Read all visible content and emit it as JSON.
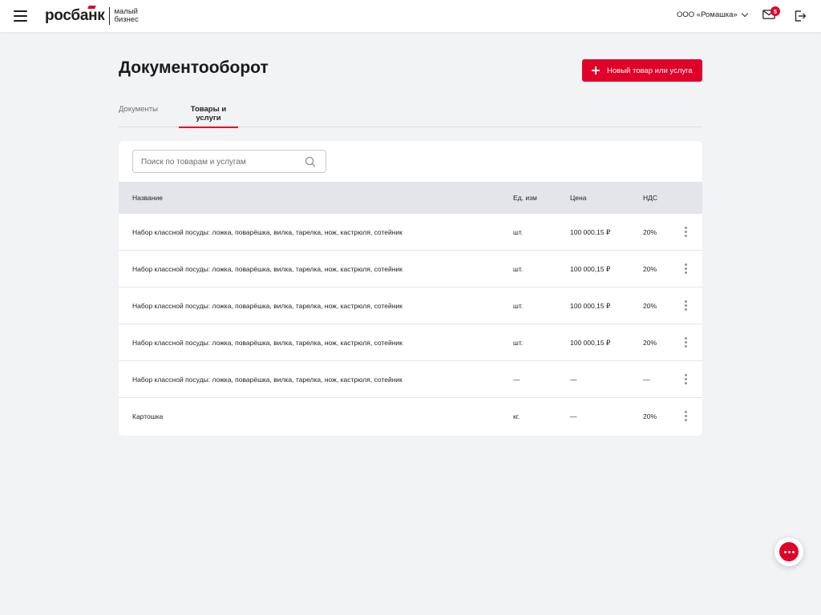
{
  "header": {
    "logo_main": "росбанк",
    "logo_sub_1": "малый",
    "logo_sub_2": "бизнес",
    "company": "ООО «Ромашка»",
    "mail_count": "5"
  },
  "page": {
    "title": "Документооборот",
    "new_button_label": "Новый товар или услуга"
  },
  "tabs": [
    {
      "label": "Документы",
      "active": false
    },
    {
      "label": "Товары и услуги",
      "active": true
    }
  ],
  "search": {
    "placeholder": "Поиск по товарам и услугам",
    "value": ""
  },
  "table": {
    "columns": [
      "Название",
      "Ед. изм",
      "Цена",
      "НДС"
    ],
    "rows": [
      {
        "name": "Набор классной посуды: ложка, поварёшка, вилка, тарелка, нож, кастрюля, сотейник",
        "unit": "шт.",
        "price": "100 000,15 ₽",
        "vat": "20%"
      },
      {
        "name": "Набор классной посуды: ложка, поварёшка, вилка, тарелка, нож, кастрюля, сотейник",
        "unit": "шт.",
        "price": "100 000,15 ₽",
        "vat": "20%"
      },
      {
        "name": "Набор классной посуды: ложка, поварёшка, вилка, тарелка, нож, кастрюля, сотейник",
        "unit": "шт.",
        "price": "100 000,15 ₽",
        "vat": "20%"
      },
      {
        "name": "Набор классной посуды: ложка, поварёшка, вилка, тарелка, нож, кастрюля, сотейник",
        "unit": "шт.",
        "price": "100 000,15 ₽",
        "vat": "20%"
      },
      {
        "name": "Набор классной посуды: ложка, поварёшка, вилка, тарелка, нож, кастрюля, сотейник",
        "unit": "—",
        "price": "—",
        "vat": "—"
      },
      {
        "name": "Картошка",
        "unit": "кг.",
        "price": "—",
        "vat": "20%"
      }
    ]
  },
  "colors": {
    "accent": "#e0002a",
    "background": "#f2f3f5",
    "table_header": "#e3e5ea"
  },
  "icons": {
    "menu": "hamburger-icon",
    "company_dropdown": "chevron-down-icon",
    "mail": "mail-icon",
    "logout": "logout-icon",
    "add": "plus-icon",
    "search": "search-icon",
    "row_menu": "more-vertical-icon",
    "chat": "chat-icon"
  }
}
